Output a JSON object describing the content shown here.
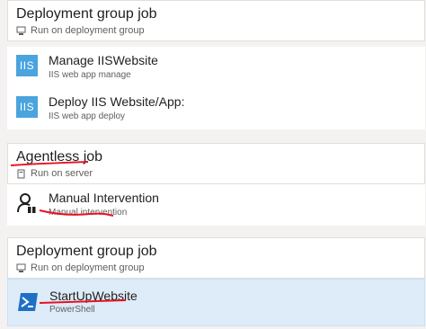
{
  "phases": [
    {
      "title": "Deployment group job",
      "subtitle": "Run on deployment group"
    },
    {
      "title": "Agentless job",
      "subtitle": "Run on server"
    },
    {
      "title": "Deployment group job",
      "subtitle": "Run on deployment group"
    }
  ],
  "tasks": [
    {
      "name": "Manage IISWebsite",
      "subtitle": "IIS web app manage",
      "icon": "iis-icon",
      "icon_text": "IIS"
    },
    {
      "name": "Deploy IIS Website/App:",
      "subtitle": "IIS web app deploy",
      "icon": "iis-icon",
      "icon_text": "IIS"
    },
    {
      "name": "Manual Intervention",
      "subtitle": "Manual intervention",
      "icon": "manual-intervention-icon"
    },
    {
      "name": "StartUpWebsite",
      "subtitle": "PowerShell",
      "icon": "powershell-icon",
      "selected": true
    }
  ],
  "colors": {
    "accent": "#0078d4",
    "selected_bg": "#deecf9",
    "iis": "#4aa4dd",
    "annotation": "#e81123"
  }
}
